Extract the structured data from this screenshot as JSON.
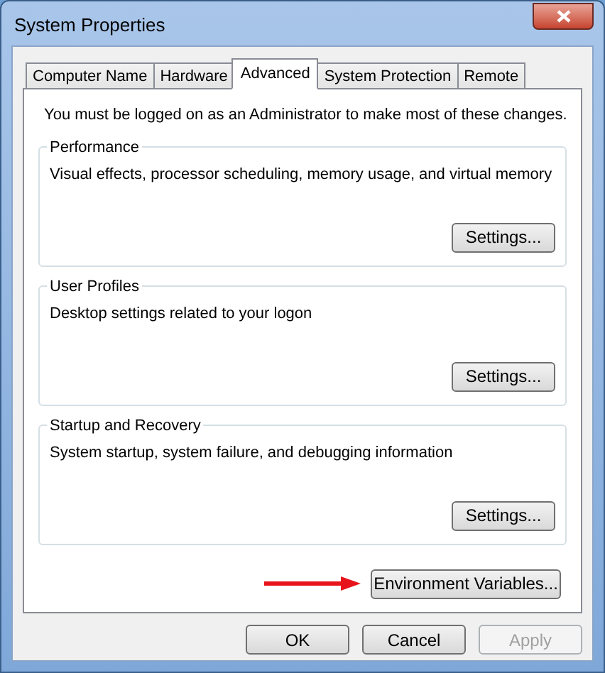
{
  "window": {
    "title": "System Properties"
  },
  "tabs": [
    {
      "label": "Computer Name",
      "selected": false
    },
    {
      "label": "Hardware",
      "selected": false
    },
    {
      "label": "Advanced",
      "selected": true
    },
    {
      "label": "System Protection",
      "selected": false
    },
    {
      "label": "Remote",
      "selected": false
    }
  ],
  "notice": "You must be logged on as an Administrator to make most of these changes.",
  "groups": [
    {
      "title": "Performance",
      "description": "Visual effects, processor scheduling, memory usage, and virtual memory",
      "button": "Settings..."
    },
    {
      "title": "User Profiles",
      "description": "Desktop settings related to your logon",
      "button": "Settings..."
    },
    {
      "title": "Startup and Recovery",
      "description": "System startup, system failure, and debugging information",
      "button": "Settings..."
    }
  ],
  "environment_button": "Environment Variables...",
  "footer_buttons": [
    {
      "label": "OK",
      "disabled": false
    },
    {
      "label": "Cancel",
      "disabled": false
    },
    {
      "label": "Apply",
      "disabled": true
    }
  ]
}
